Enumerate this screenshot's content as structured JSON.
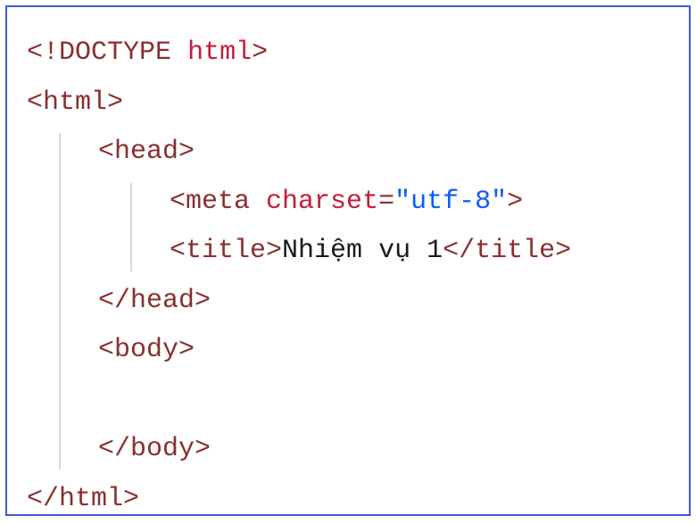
{
  "code": {
    "line1": {
      "open": "<!",
      "doctype": "DOCTYPE",
      "space": " ",
      "html": "html",
      "close": ">"
    },
    "line2": {
      "open": "<",
      "tag": "html",
      "close": ">"
    },
    "line3": {
      "open": "<",
      "tag": "head",
      "close": ">"
    },
    "line4": {
      "open": "<",
      "tag": "meta",
      "space": " ",
      "attr": "charset",
      "eq": "=",
      "val": "\"utf-8\"",
      "close": ">"
    },
    "line5": {
      "open": "<",
      "tag": "title",
      "close": ">",
      "text": "Nhiệm vụ 1",
      "open2": "</",
      "tag2": "title",
      "close2": ">"
    },
    "line6": {
      "open": "</",
      "tag": "head",
      "close": ">"
    },
    "line7": {
      "open": "<",
      "tag": "body",
      "close": ">"
    },
    "line8_blank": " ",
    "line9": {
      "open": "</",
      "tag": "body",
      "close": ">"
    },
    "line10": {
      "open": "</",
      "tag": "html",
      "close": ">"
    }
  }
}
